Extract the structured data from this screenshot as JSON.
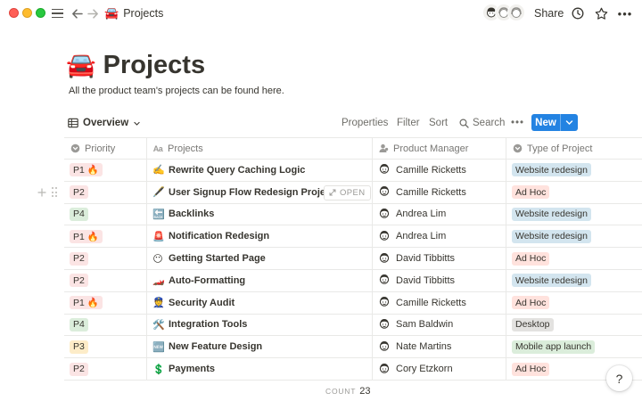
{
  "topbar": {
    "breadcrumb_emoji": "🚘",
    "breadcrumb": "Projects",
    "share": "Share",
    "more": "•••",
    "help": "?"
  },
  "page": {
    "emoji": "🚘",
    "title": "Projects",
    "description": "All the product team's projects can be found here."
  },
  "toolbar": {
    "view_name": "Overview",
    "properties": "Properties",
    "filter": "Filter",
    "sort": "Sort",
    "search": "Search",
    "more": "•••",
    "new_label": "New"
  },
  "table": {
    "columns": [
      {
        "label": "Priority",
        "icon": "status-icon"
      },
      {
        "label": "Projects",
        "icon": "text-icon"
      },
      {
        "label": "Product Manager",
        "icon": "person-icon"
      },
      {
        "label": "Type of Project",
        "icon": "select-icon"
      }
    ],
    "open_label": "OPEN",
    "rows": [
      {
        "priority": "P1 🔥",
        "project_emoji": "✍️",
        "project": "Rewrite Query Caching Logic",
        "manager": "Camille Ricketts",
        "type": "Website redesign"
      },
      {
        "priority": "P2",
        "project_emoji": "🖋️",
        "project": "User Signup Flow Redesign Project",
        "manager": "Camille Ricketts",
        "type": "Ad Hoc"
      },
      {
        "priority": "P4",
        "project_emoji": "🔙",
        "project": "Backlinks",
        "manager": "Andrea Lim",
        "type": "Website redesign"
      },
      {
        "priority": "P1 🔥",
        "project_emoji": "🚨",
        "project": "Notification Redesign",
        "manager": "Andrea Lim",
        "type": "Website redesign"
      },
      {
        "priority": "P2",
        "project_emoji": "😶",
        "project": "Getting Started Page",
        "manager": "David Tibbitts",
        "type": "Ad Hoc"
      },
      {
        "priority": "P2",
        "project_emoji": "🏎️",
        "project": "Auto-Formatting",
        "manager": "David Tibbitts",
        "type": "Website redesign"
      },
      {
        "priority": "P1 🔥",
        "project_emoji": "👮",
        "project": "Security Audit",
        "manager": "Camille Ricketts",
        "type": "Ad Hoc"
      },
      {
        "priority": "P4",
        "project_emoji": "🛠️",
        "project": "Integration Tools",
        "manager": "Sam Baldwin",
        "type": "Desktop"
      },
      {
        "priority": "P3",
        "project_emoji": "🆕",
        "project": "New Feature Design",
        "manager": "Nate Martins",
        "type": "Mobile app launch"
      },
      {
        "priority": "P2",
        "project_emoji": "💲",
        "project": "Payments",
        "manager": "Cory Etzkorn",
        "type": "Ad Hoc"
      }
    ]
  },
  "footer": {
    "count_label": "COUNT",
    "count_value": "23"
  },
  "colors": {
    "P1": "#fbe4e4",
    "P2": "#fbe4e4",
    "P3": "#fdecc8",
    "P4": "#dbeddb",
    "Website redesign": "#d3e5ef",
    "Ad Hoc": "#ffe2dd",
    "Desktop": "#e3e2e0",
    "Mobile app launch": "#dbeddb",
    "accent": "#2383e2"
  }
}
